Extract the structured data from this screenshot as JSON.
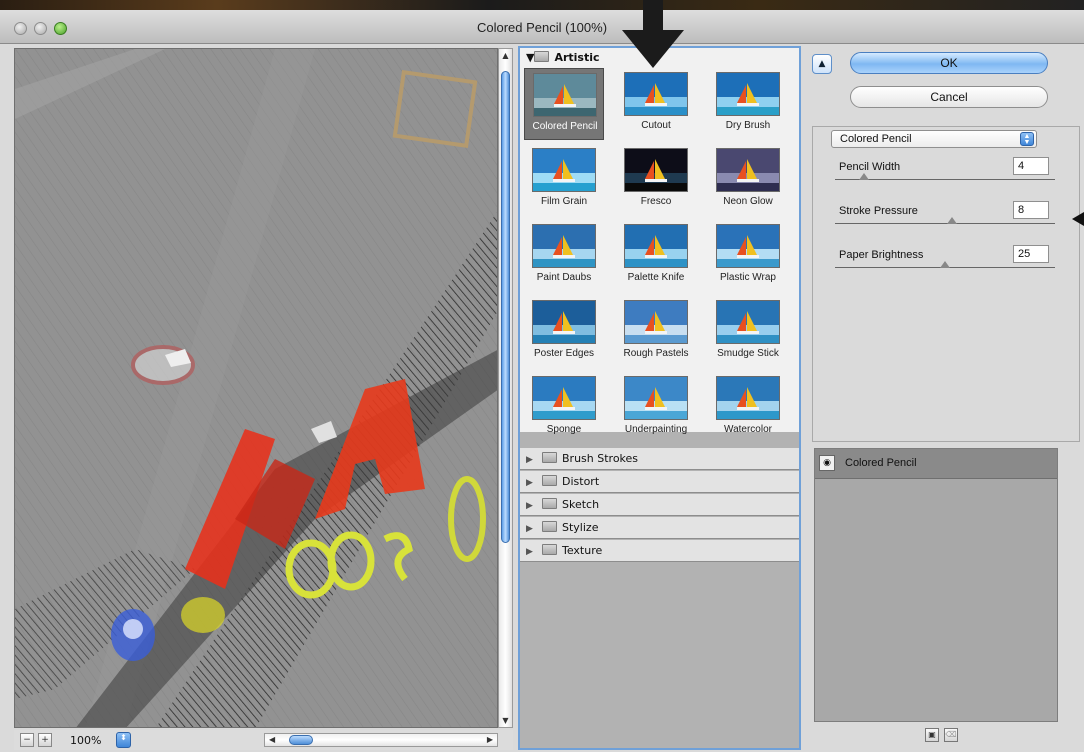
{
  "window": {
    "title": "Colored Pencil (100%)"
  },
  "preview": {
    "zoom": "100%",
    "zoom_minus": "−",
    "zoom_plus": "+",
    "stepper": "⬍"
  },
  "gallery": {
    "expanded_category": "Artistic",
    "filters": [
      {
        "label": "Colored Pencil",
        "selected": true
      },
      {
        "label": "Cutout"
      },
      {
        "label": "Dry Brush"
      },
      {
        "label": "Film Grain"
      },
      {
        "label": "Fresco"
      },
      {
        "label": "Neon Glow"
      },
      {
        "label": "Paint Daubs"
      },
      {
        "label": "Palette Knife"
      },
      {
        "label": "Plastic Wrap"
      },
      {
        "label": "Poster Edges"
      },
      {
        "label": "Rough Pastels"
      },
      {
        "label": "Smudge Stick"
      },
      {
        "label": "Sponge"
      },
      {
        "label": "Underpainting"
      },
      {
        "label": "Watercolor"
      }
    ],
    "categories": [
      "Brush Strokes",
      "Distort",
      "Sketch",
      "Stylize",
      "Texture"
    ]
  },
  "buttons": {
    "ok": "OK",
    "cancel": "Cancel",
    "collapse": "▲"
  },
  "settings": {
    "filter_name": "Colored Pencil",
    "params": [
      {
        "label": "Pencil Width",
        "value": "4",
        "min": 1,
        "max": 24
      },
      {
        "label": "Stroke Pressure",
        "value": "8",
        "min": 0,
        "max": 15
      },
      {
        "label": "Paper Brightness",
        "value": "25",
        "min": 0,
        "max": 50
      }
    ]
  },
  "layers": {
    "items": [
      {
        "name": "Colored Pencil",
        "visible": true
      }
    ]
  },
  "colors": {
    "accent_blue": "#6fa0d8",
    "neon_red": "#e8301a",
    "neon_yellow": "#d8e23a"
  }
}
